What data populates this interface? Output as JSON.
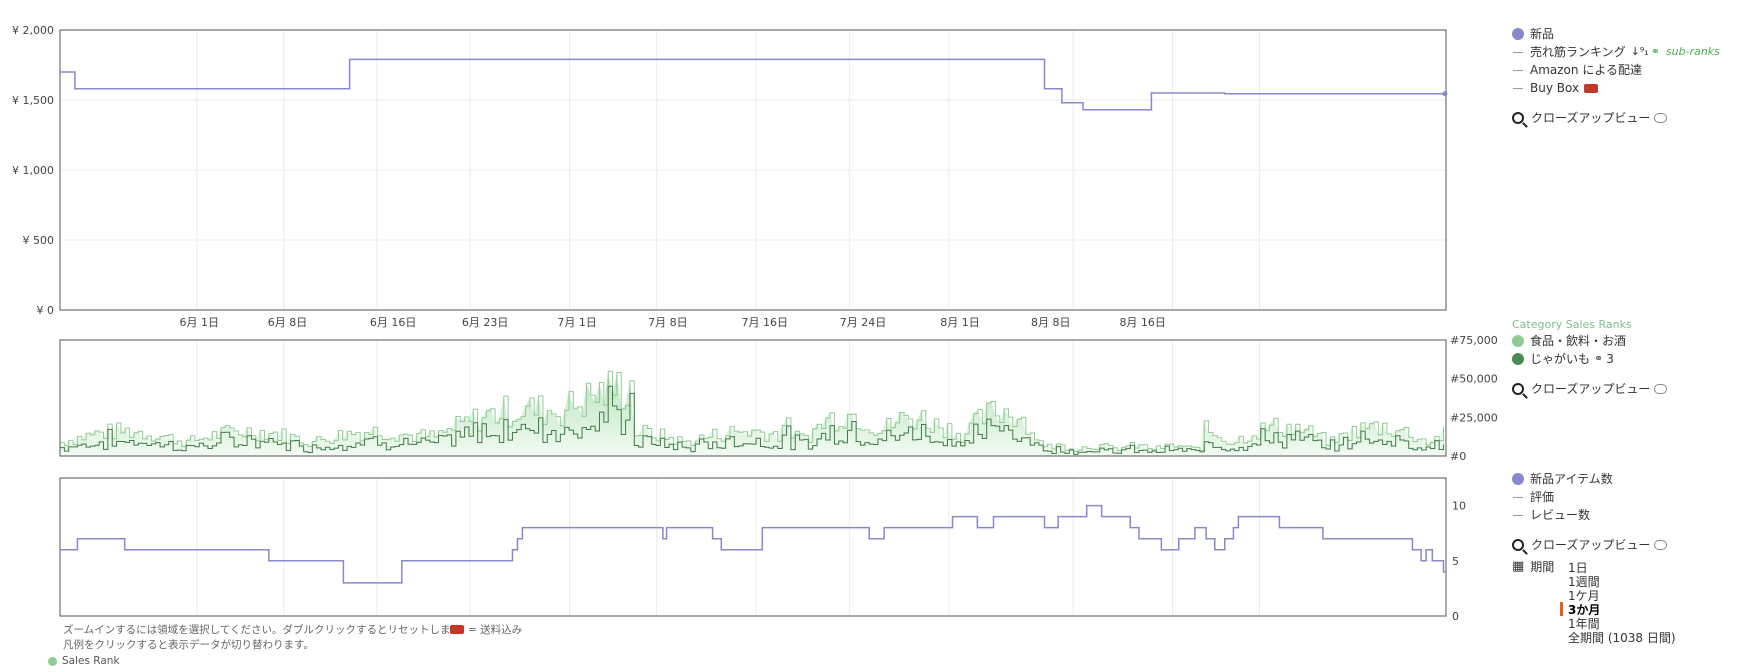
{
  "chart_data": [
    {
      "type": "line",
      "title": "",
      "x_labels": [
        "6月 1日",
        "6月 8日",
        "6月 16日",
        "6月 23日",
        "7月 1日",
        "7月 8日",
        "7月 16日",
        "7月 24日",
        "8月 1日",
        "8月 8日",
        "8月 16日"
      ],
      "y_ticks": [
        "¥ 0",
        "¥ 500",
        "¥ 1,000",
        "¥ 1,500",
        "¥ 2,000"
      ],
      "ylim": [
        0,
        2000
      ],
      "grid": true,
      "legend_position": "right",
      "series": [
        {
          "name": "新品",
          "color": "#8888cc",
          "steps": [
            {
              "x": 0,
              "y": 1700
            },
            {
              "x": 1.2,
              "y": 1580
            },
            {
              "x": 23.3,
              "y": 1790
            },
            {
              "x": 79.2,
              "y": 1580
            },
            {
              "x": 80.6,
              "y": 1480
            },
            {
              "x": 82.3,
              "y": 1430
            },
            {
              "x": 87.8,
              "y": 1550
            },
            {
              "x": 93.7,
              "y": 1545
            },
            {
              "x": 111.5,
              "y": 1545
            }
          ]
        }
      ]
    },
    {
      "type": "area",
      "title": "Category Sales Ranks",
      "y_ticks": [
        "#0",
        "#25,000",
        "#50,000",
        "#75,000"
      ],
      "ylim": [
        0,
        75000
      ],
      "series": [
        {
          "name": "食品・飲料・お酒",
          "color": "#8fcc94",
          "fill": "#e8f5e9"
        },
        {
          "name": "じゃがいも",
          "color": "#3d7a45"
        }
      ]
    },
    {
      "type": "line",
      "y_ticks": [
        "0",
        "5",
        "10"
      ],
      "ylim": [
        0,
        12.5
      ],
      "series": [
        {
          "name": "新品アイテム数",
          "color": "#8888cc",
          "steps": [
            {
              "x": 0,
              "y": 6
            },
            {
              "x": 1.4,
              "y": 7
            },
            {
              "x": 5.2,
              "y": 6
            },
            {
              "x": 16.8,
              "y": 5
            },
            {
              "x": 22.8,
              "y": 3
            },
            {
              "x": 27.5,
              "y": 5
            },
            {
              "x": 36.4,
              "y": 6
            },
            {
              "x": 36.8,
              "y": 7
            },
            {
              "x": 37.2,
              "y": 8
            },
            {
              "x": 48.5,
              "y": 7
            },
            {
              "x": 48.8,
              "y": 8
            },
            {
              "x": 52.5,
              "y": 7
            },
            {
              "x": 53.2,
              "y": 6
            },
            {
              "x": 56.5,
              "y": 8
            },
            {
              "x": 65.1,
              "y": 7
            },
            {
              "x": 66.3,
              "y": 8
            },
            {
              "x": 71.8,
              "y": 9
            },
            {
              "x": 73.8,
              "y": 8
            },
            {
              "x": 75.1,
              "y": 9
            },
            {
              "x": 79.2,
              "y": 8
            },
            {
              "x": 80.3,
              "y": 9
            },
            {
              "x": 82.6,
              "y": 10
            },
            {
              "x": 83.8,
              "y": 9
            },
            {
              "x": 86.1,
              "y": 8
            },
            {
              "x": 86.8,
              "y": 7
            },
            {
              "x": 88.6,
              "y": 6
            },
            {
              "x": 90,
              "y": 7
            },
            {
              "x": 91.3,
              "y": 8
            },
            {
              "x": 92.2,
              "y": 7
            },
            {
              "x": 92.9,
              "y": 6
            },
            {
              "x": 93.7,
              "y": 7
            },
            {
              "x": 94.4,
              "y": 8
            },
            {
              "x": 94.8,
              "y": 9
            },
            {
              "x": 98.1,
              "y": 8
            },
            {
              "x": 101.6,
              "y": 7
            },
            {
              "x": 108.8,
              "y": 6
            },
            {
              "x": 109.5,
              "y": 5
            },
            {
              "x": 109.9,
              "y": 6
            },
            {
              "x": 110.4,
              "y": 5
            },
            {
              "x": 111.3,
              "y": 4
            },
            {
              "x": 111.5,
              "y": 4
            }
          ]
        }
      ]
    }
  ],
  "legend1": {
    "new_label": "新品",
    "sales_rank_label": "売れ筋ランキング",
    "sales_rank_icon": "sort-icon",
    "sub_ranks_label": "sub-ranks",
    "amazon_label": "Amazon による配達",
    "buybox_label": "Buy Box",
    "closeup_label": "クローズアップビュー",
    "colors": {
      "new": "#8888cc",
      "line": "#9a9a9a"
    }
  },
  "legend2": {
    "title": "Category Sales Ranks",
    "cat1_label": "食品・飲料・お酒",
    "cat2_label": "じゃがいも",
    "cat2_suffix": "3",
    "closeup_label": "クローズアップビュー",
    "colors": {
      "cat1": "#8fcc94",
      "cat2": "#4a8a53"
    }
  },
  "legend3": {
    "new_count_label": "新品アイテム数",
    "rating_label": "評価",
    "review_count_label": "レビュー数",
    "closeup_label": "クローズアップビュー"
  },
  "period": {
    "label": "期間",
    "options": [
      "1日",
      "1週間",
      "1ケ月",
      "3か月",
      "1年間",
      "全期間 (1038 日間)"
    ],
    "selected": "3か月"
  },
  "notes": {
    "zoom_hint": "ズームインするには領域を選択してください。ダブルクリックするとリセットします。",
    "shipping": "= 送料込み",
    "legend_hint": "凡例をクリックすると表示データが切り替わります。",
    "sales_rank": "Sales Rank"
  }
}
